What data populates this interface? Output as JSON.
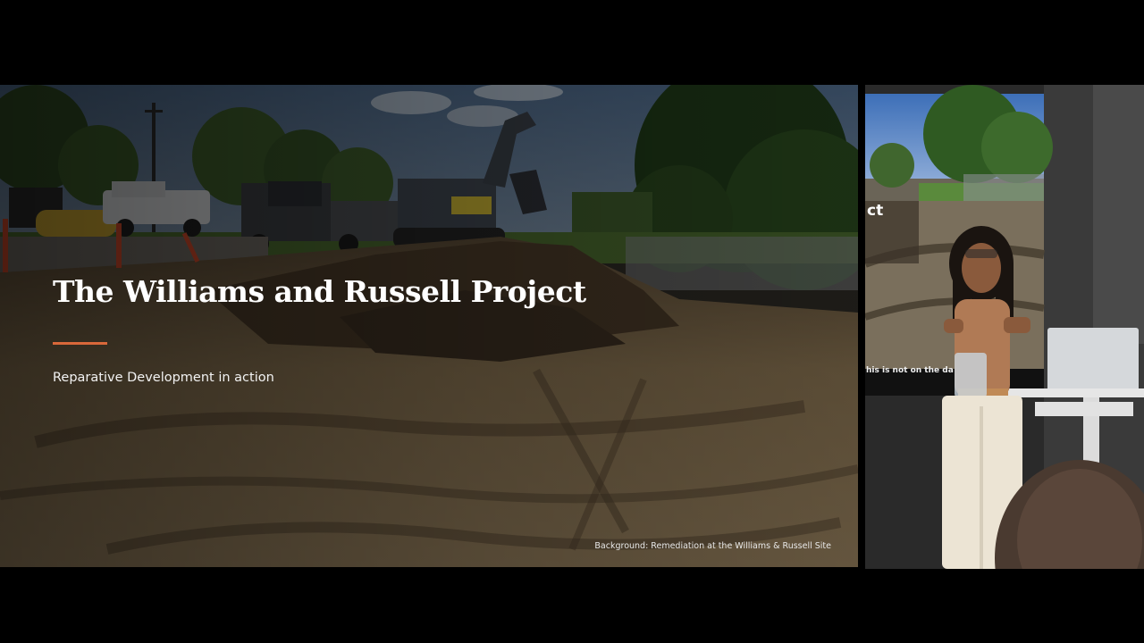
{
  "slide": {
    "title": "The Williams and Russell Project",
    "subtitle": "Reparative Development in action",
    "caption": "Background: Remediation at the Williams & Russell Site",
    "accent_color": "#d9683a"
  },
  "camera": {
    "screen_fragment": "ct",
    "screen_caption": "his is not on the da"
  }
}
